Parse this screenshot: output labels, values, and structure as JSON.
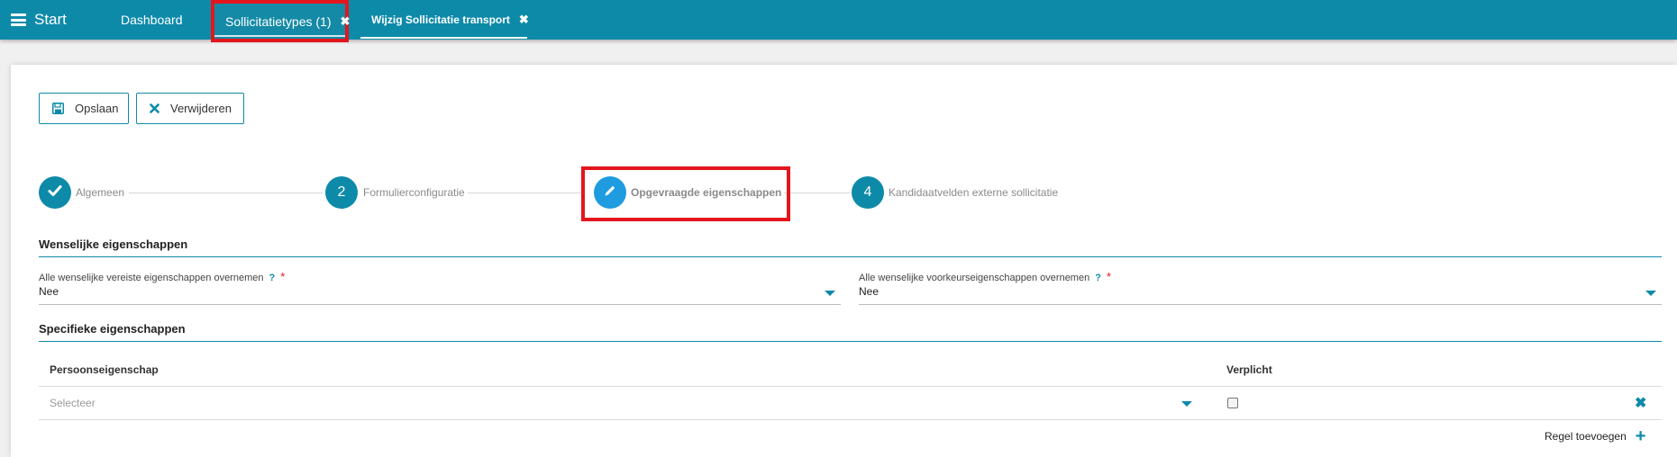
{
  "topbar": {
    "start_label": "Start",
    "tabs": [
      {
        "label": "Dashboard"
      },
      {
        "label": "Sollicitatietypes (1)",
        "close": "✖"
      },
      {
        "label": "Wijzig Sollicitatie transport",
        "close": "✖"
      }
    ]
  },
  "toolbar": {
    "save_label": "Opslaan",
    "delete_label": "Verwijderen"
  },
  "stepper": {
    "steps": [
      {
        "number": "",
        "label": "Algemeen",
        "state": "completed",
        "icon": "check-icon"
      },
      {
        "number": "2",
        "label": "Formulierconfiguratie",
        "state": "pending"
      },
      {
        "number": "",
        "label": "Opgevraagde eigenschappen",
        "state": "active",
        "icon": "pencil-icon"
      },
      {
        "number": "4",
        "label": "Kandidaatvelden externe sollicitatie",
        "state": "pending"
      }
    ]
  },
  "wenselijk": {
    "title": "Wenselijke eigenschappen",
    "field1": {
      "label": "Alle wenselijke vereiste eigenschappen overnemen",
      "help": "?",
      "required": "*",
      "value": "Nee"
    },
    "field2": {
      "label": "Alle wenselijke voorkeurseigenschappen overnemen",
      "help": "?",
      "required": "*",
      "value": "Nee"
    }
  },
  "specifiek": {
    "title": "Specifieke eigenschappen",
    "columns": [
      "Persoonseigenschap",
      "Verplicht"
    ],
    "row": {
      "placeholder": "Selecteer",
      "checked": false
    },
    "add_label": "Regel toevoegen"
  },
  "colors": {
    "primary": "#0e8aa9",
    "active_step": "#1f9be0",
    "highlight": "#e3161d"
  }
}
